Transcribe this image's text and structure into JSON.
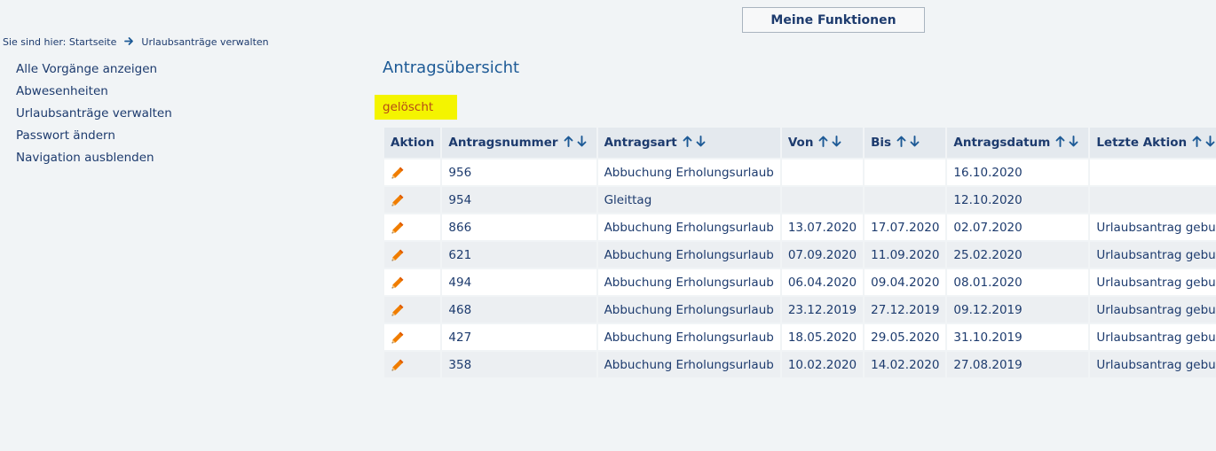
{
  "header": {
    "functions_button": "Meine Funktionen"
  },
  "breadcrumb": {
    "prefix": "Sie sind hier:",
    "items": [
      "Startseite",
      "Urlaubsanträge verwalten"
    ]
  },
  "sidebar": {
    "items": [
      {
        "label": "Alle Vorgänge anzeigen"
      },
      {
        "label": "Abwesenheiten"
      },
      {
        "label": "Urlaubsanträge verwalten"
      },
      {
        "label": "Passwort ändern"
      },
      {
        "label": "Navigation ausblenden"
      }
    ]
  },
  "main": {
    "title": "Antragsübersicht",
    "status": "gelöscht",
    "columns": [
      "Aktion",
      "Antragsnummer",
      "Antragsart",
      "Von",
      "Bis",
      "Antragsdatum",
      "Letzte Aktion"
    ],
    "rows": [
      {
        "nummer": "956",
        "art": "Abbuchung Erholungsurlaub",
        "von": "",
        "bis": "",
        "datum": "16.10.2020",
        "aktion": ""
      },
      {
        "nummer": "954",
        "art": "Gleittag",
        "von": "",
        "bis": "",
        "datum": "12.10.2020",
        "aktion": ""
      },
      {
        "nummer": "866",
        "art": "Abbuchung Erholungsurlaub",
        "von": "13.07.2020",
        "bis": "17.07.2020",
        "datum": "02.07.2020",
        "aktion": "Urlaubsantrag gebucht"
      },
      {
        "nummer": "621",
        "art": "Abbuchung Erholungsurlaub",
        "von": "07.09.2020",
        "bis": "11.09.2020",
        "datum": "25.02.2020",
        "aktion": "Urlaubsantrag gebucht"
      },
      {
        "nummer": "494",
        "art": "Abbuchung Erholungsurlaub",
        "von": "06.04.2020",
        "bis": "09.04.2020",
        "datum": "08.01.2020",
        "aktion": "Urlaubsantrag gebucht"
      },
      {
        "nummer": "468",
        "art": "Abbuchung Erholungsurlaub",
        "von": "23.12.2019",
        "bis": "27.12.2019",
        "datum": "09.12.2019",
        "aktion": "Urlaubsantrag gebucht"
      },
      {
        "nummer": "427",
        "art": "Abbuchung Erholungsurlaub",
        "von": "18.05.2020",
        "bis": "29.05.2020",
        "datum": "31.10.2019",
        "aktion": "Urlaubsantrag gebucht"
      },
      {
        "nummer": "358",
        "art": "Abbuchung Erholungsurlaub",
        "von": "10.02.2020",
        "bis": "14.02.2020",
        "datum": "27.08.2019",
        "aktion": "Urlaubsantrag gebucht"
      }
    ]
  },
  "colors": {
    "background": "#f1f4f6",
    "text": "#1d3b6e",
    "title": "#1d5a96",
    "badge_bg": "#f4f400",
    "badge_text": "#b64a17",
    "sort_arrow": "#1d5a96",
    "edit_icon": "#f07d00"
  },
  "icons": {
    "breadcrumb_separator": "arrow-right-icon",
    "sort_asc": "arrow-up-icon",
    "sort_desc": "arrow-down-icon",
    "row_action": "pencil-icon"
  }
}
